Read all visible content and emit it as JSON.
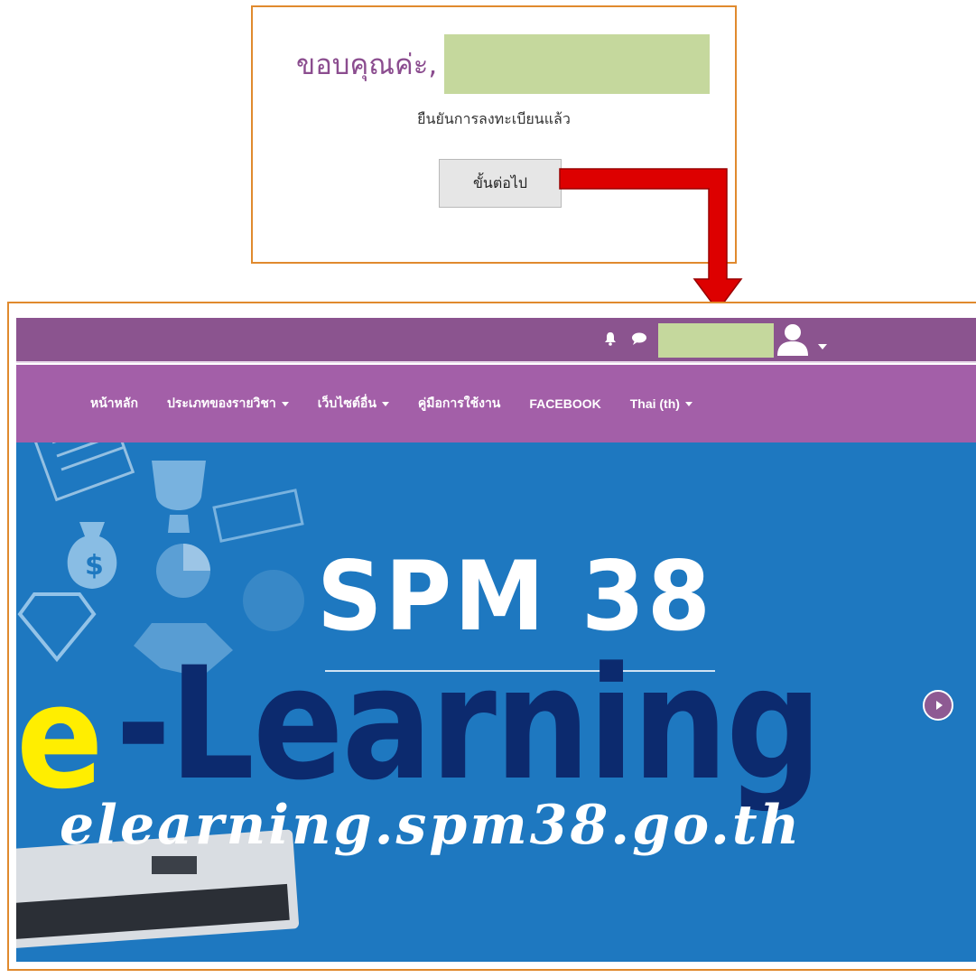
{
  "confirmation": {
    "thanks": "ขอบคุณค่ะ,",
    "message": "ยืนยันการลงทะเบียนแล้ว",
    "next_button": "ขั้นต่อไป"
  },
  "site": {
    "nav": [
      {
        "label": "หน้าหลัก",
        "dropdown": false
      },
      {
        "label": "ประเภทของรายวิชา",
        "dropdown": true
      },
      {
        "label": "เว็บไซต์อื่น",
        "dropdown": true
      },
      {
        "label": "คู่มือการใช้งาน",
        "dropdown": false
      },
      {
        "label": "FACEBOOK",
        "dropdown": false
      },
      {
        "label": "Thai (th)",
        "dropdown": true
      }
    ],
    "banner": {
      "title": "SPM 38",
      "e": "e",
      "dash": "-",
      "learning": "Learning",
      "url": "elearning.spm38.go.th"
    }
  },
  "colors": {
    "frame": "#e08a2e",
    "topbar": "#8b548f",
    "navbar": "#a35fa8",
    "banner": "#1e78c0",
    "arrow": "#dd0000",
    "redacted": "#c5d89d"
  }
}
